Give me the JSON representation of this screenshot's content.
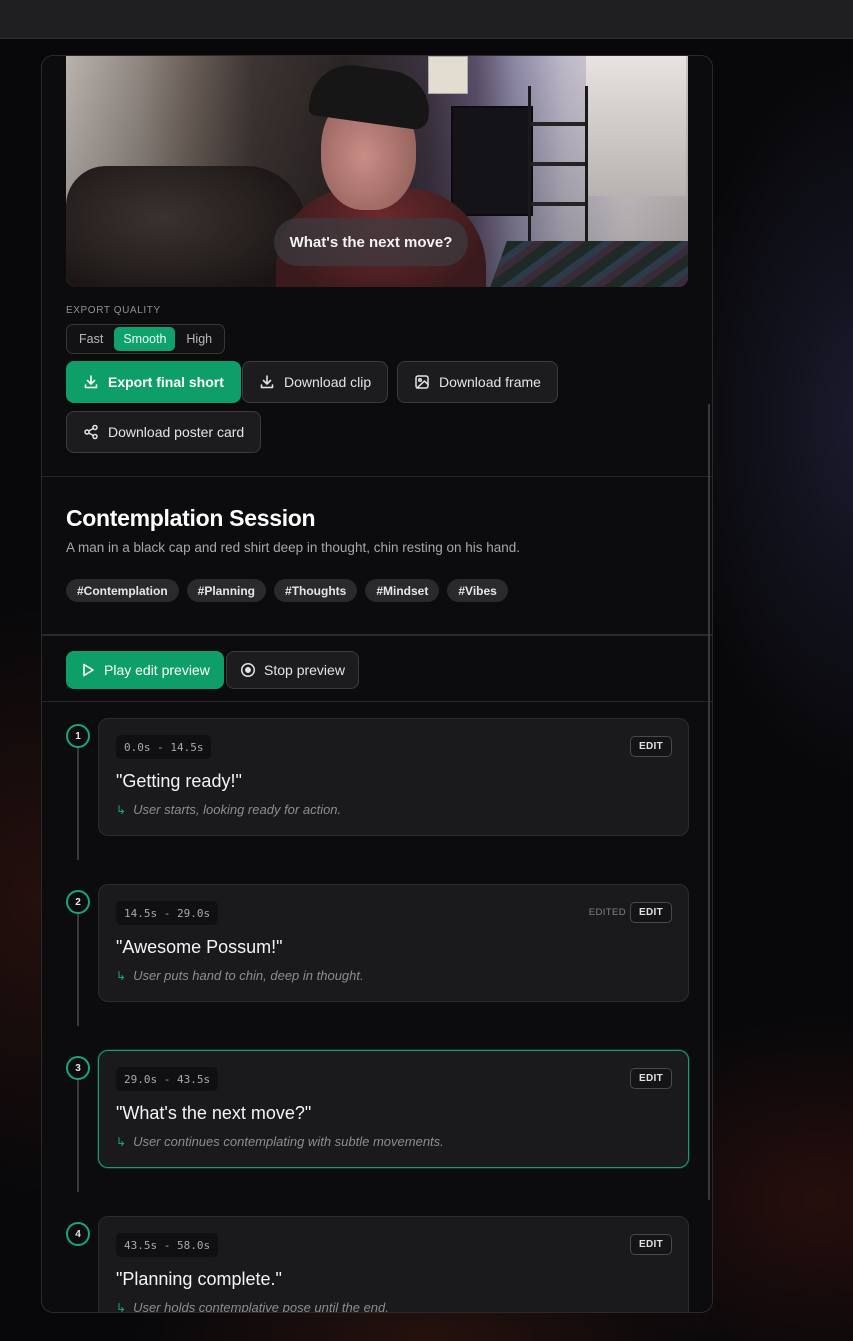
{
  "preview": {
    "caption": "What's the next move?"
  },
  "export": {
    "section_label": "EXPORT QUALITY",
    "quality_options": [
      "Fast",
      "Smooth",
      "High"
    ],
    "selected_quality": "Smooth",
    "buttons": {
      "export_final": "Export final short",
      "download_clip": "Download clip",
      "download_frame": "Download frame",
      "download_poster": "Download poster card"
    }
  },
  "project": {
    "title": "Contemplation Session",
    "description": "A man in a black cap and red shirt deep in thought, chin resting on his hand.",
    "tags": [
      "#Contemplation",
      "#Planning",
      "#Thoughts",
      "#Mindset",
      "#Vibes"
    ]
  },
  "playback": {
    "play_label": "Play edit preview",
    "stop_label": "Stop preview"
  },
  "segments": [
    {
      "number": "1",
      "time": "0.0s - 14.5s",
      "quote": "\"Getting ready!\"",
      "note": "User starts, looking ready for action.",
      "edited": "",
      "edit_label": "EDIT",
      "active": false
    },
    {
      "number": "2",
      "time": "14.5s - 29.0s",
      "quote": "\"Awesome Possum!\"",
      "note": "User puts hand to chin, deep in thought.",
      "edited": "EDITED",
      "edit_label": "EDIT",
      "active": false
    },
    {
      "number": "3",
      "time": "29.0s - 43.5s",
      "quote": "\"What's the next move?\"",
      "note": "User continues contemplating with subtle movements.",
      "edited": "",
      "edit_label": "EDIT",
      "active": true
    },
    {
      "number": "4",
      "time": "43.5s - 58.0s",
      "quote": "\"Planning complete.\"",
      "note": "User holds contemplative pose until the end.",
      "edited": "",
      "edit_label": "EDIT",
      "active": false
    }
  ],
  "colors": {
    "accent": "#0e9f68",
    "background": "#0c0c0e"
  }
}
